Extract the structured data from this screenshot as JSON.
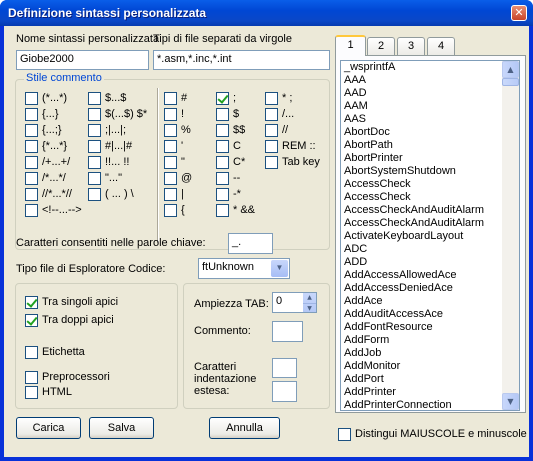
{
  "window": {
    "title": "Definizione sintassi personalizzata"
  },
  "name_label": "Nome sintassi personalizzata",
  "name_value": "Giobe2000",
  "ext_label": "Tipi di file separati da virgole",
  "ext_value": "*.asm,*.inc,*.int",
  "comment_group": {
    "legend": "Stile commento",
    "col1": [
      {
        "label": "(*...*)",
        "checked": false
      },
      {
        "label": "{...}",
        "checked": false
      },
      {
        "label": "{...;}",
        "checked": false
      },
      {
        "label": "{*...*}",
        "checked": false
      },
      {
        "label": "/+...+/",
        "checked": false
      },
      {
        "label": "/*...*/",
        "checked": false
      },
      {
        "label": "//*...*//",
        "checked": false
      },
      {
        "label": "<!--...-->",
        "checked": false
      }
    ],
    "col2": [
      {
        "label": "$...$",
        "checked": false
      },
      {
        "label": "$(...$) $*",
        "checked": false
      },
      {
        "label": ";|...|;",
        "checked": false
      },
      {
        "label": "#|...|#",
        "checked": false
      },
      {
        "label": "!!... !!",
        "checked": false
      },
      {
        "label": "\"...\"",
        "checked": false
      },
      {
        "label": "( ... ) \\",
        "checked": false
      }
    ],
    "col3": [
      {
        "label": "#",
        "checked": false
      },
      {
        "label": "!",
        "checked": false
      },
      {
        "label": "%",
        "checked": false
      },
      {
        "label": "'",
        "checked": false
      },
      {
        "label": "\"",
        "checked": false
      },
      {
        "label": "@",
        "checked": false
      },
      {
        "label": "|",
        "checked": false
      },
      {
        "label": "{",
        "checked": false
      }
    ],
    "col4": [
      {
        "label": ";",
        "checked": true
      },
      {
        "label": "$",
        "checked": false
      },
      {
        "label": "$$",
        "checked": false
      },
      {
        "label": "C",
        "checked": false
      },
      {
        "label": "C*",
        "checked": false
      },
      {
        "label": "--",
        "checked": false
      },
      {
        "label": "-*",
        "checked": false
      },
      {
        "label": "* &&",
        "checked": false
      }
    ],
    "col5": [
      {
        "label": "* ;",
        "checked": false
      },
      {
        "label": "/...",
        "checked": false
      },
      {
        "label": "//",
        "checked": false
      },
      {
        "label": "REM ::",
        "checked": false
      },
      {
        "label": "Tab key",
        "checked": false
      }
    ]
  },
  "keyword_chars_label": "Caratteri consentiti nelle parole chiave:",
  "keyword_chars_value": "_.",
  "explorer_label": "Tipo file di Esploratore Codice:",
  "explorer_value": "ftUnknown",
  "quotes_group": {
    "items": [
      {
        "label": "Tra singoli apici",
        "checked": true
      },
      {
        "label": "Tra doppi apici",
        "checked": true
      },
      {
        "label": "Etichetta",
        "checked": false
      },
      {
        "label": "Preprocessori",
        "checked": false
      },
      {
        "label": "HTML",
        "checked": false
      }
    ]
  },
  "tab_width_label": "Ampiezza TAB:",
  "tab_width_value": "0",
  "comment_label": "Commento:",
  "indent_label": "Caratteri indentazione estesa:",
  "tabs": [
    "1",
    "2",
    "3",
    "4"
  ],
  "keywords": [
    "_wsprintfA",
    "AAA",
    "AAD",
    "AAM",
    "AAS",
    "AbortDoc",
    "AbortPath",
    "AbortPrinter",
    "AbortSystemShutdown",
    "AccessCheck",
    "AccessCheck",
    "AccessCheckAndAuditAlarm",
    "AccessCheckAndAuditAlarm",
    "ActivateKeyboardLayout",
    "ADC",
    "ADD",
    "AddAccessAllowedAce",
    "AddAccessDeniedAce",
    "AddAce",
    "AddAuditAccessAce",
    "AddFontResource",
    "AddForm",
    "AddJob",
    "AddMonitor",
    "AddPort",
    "AddPrinter",
    "AddPrinterConnection"
  ],
  "buttons": {
    "load": "Carica",
    "save": "Salva",
    "cancel": "Annulla"
  },
  "case_label": "Distingui MAIUSCOLE e minuscole"
}
